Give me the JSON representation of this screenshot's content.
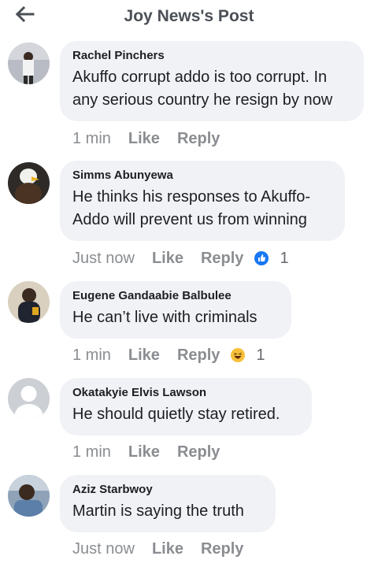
{
  "header": {
    "title": "Joy News's Post",
    "back_icon": "arrow-left-icon"
  },
  "comments": [
    {
      "author": "Rachel Pinchers",
      "text": "Akuffo corrupt addo is too corrupt. In any serious country he resign by now",
      "time": "1 min",
      "like_label": "Like",
      "reply_label": "Reply",
      "reaction": null
    },
    {
      "author": "Simms Abunyewa",
      "text": "He thinks his responses to Akuffo-Addo will prevent us from winning",
      "time": "Just now",
      "like_label": "Like",
      "reply_label": "Reply",
      "reaction": {
        "icon": "like-reaction-icon",
        "count": "1"
      }
    },
    {
      "author": "Eugene Gandaabie Balbulee",
      "text": "He can’t live with criminals",
      "time": "1 min",
      "like_label": "Like",
      "reply_label": "Reply",
      "reaction": {
        "icon": "haha-reaction-icon",
        "count": "1"
      }
    },
    {
      "author": "Okatakyie Elvis Lawson",
      "text": "He should quietly stay retired.",
      "time": "1 min",
      "like_label": "Like",
      "reply_label": "Reply",
      "reaction": null
    },
    {
      "author": "Aziz Starbwoy",
      "text": "Martin is saying the truth",
      "time": "Just now",
      "like_label": "Like",
      "reply_label": "Reply",
      "reaction": null
    }
  ],
  "colors": {
    "bubble": "#f0f2f5",
    "meta_text": "#8a8d91",
    "like_blue": "#1877f2",
    "haha_yellow": "#f7c03a"
  }
}
